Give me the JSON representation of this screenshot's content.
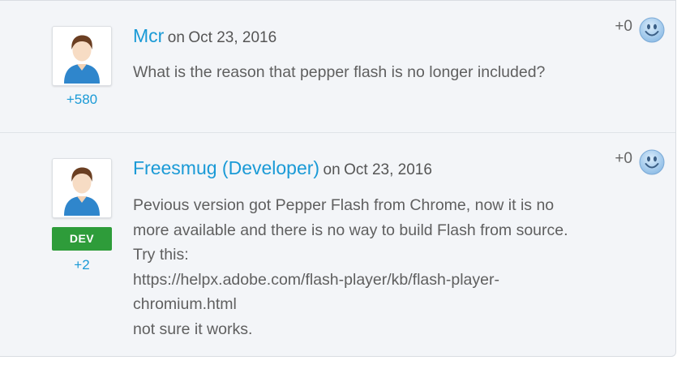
{
  "comments": [
    {
      "author": "Mcr",
      "on": "on",
      "date": "Oct 23, 2016",
      "score": "+580",
      "votes": "+0",
      "badge": "",
      "body": [
        "What is the reason that pepper flash is no longer included?"
      ]
    },
    {
      "author": "Freesmug (Developer)",
      "on": "on",
      "date": "Oct 23, 2016",
      "score": "+2",
      "votes": "+0",
      "badge": "DEV",
      "body": [
        "Pevious version got Pepper Flash from Chrome, now it is no",
        "more available and there is no way to build Flash from source.",
        "Try this:",
        "https://helpx.adobe.com/flash-player/kb/flash-player-",
        "chromium.html",
        "not sure it works."
      ]
    }
  ],
  "colors": {
    "link": "#1a9ad6",
    "dev_badge": "#2e9c3a",
    "background": "#f3f5f8"
  },
  "icons": [
    "default-user-avatar-icon",
    "smiley-upvote-icon"
  ]
}
